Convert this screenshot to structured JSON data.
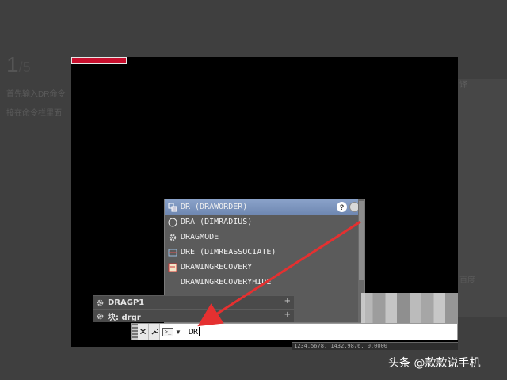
{
  "background_page": {
    "step_number": "1",
    "step_total": "/5",
    "line1": "首先输入DR命令",
    "line2": "接在命令栏里面",
    "right_label": "译",
    "right_logo": "百度"
  },
  "autocomplete": {
    "items": [
      {
        "label": "DR (DRAWORDER)",
        "icon": "draworder-icon",
        "selected": true
      },
      {
        "label": "DRA (DIMRADIUS)",
        "icon": "dimradius-icon",
        "selected": false
      },
      {
        "label": "DRAGMODE",
        "icon": "gear-icon",
        "selected": false
      },
      {
        "label": "DRE (DIMREASSOCIATE)",
        "icon": "dimreassociate-icon",
        "selected": false
      },
      {
        "label": "DRAWINGRECOVERY",
        "icon": "drawingrecovery-icon",
        "selected": false
      },
      {
        "label": "DRAWINGRECOVERYHIDE",
        "icon": "",
        "selected": false
      }
    ],
    "help_label": "?"
  },
  "history": [
    {
      "label": "DRAGP1",
      "icon": "gear-icon",
      "plus": "+"
    },
    {
      "label": "块: drgr",
      "icon": "block-icon",
      "plus": "+"
    }
  ],
  "command_line": {
    "close_label": "✕",
    "wrench_label": "🔧",
    "prompt_label": ">_",
    "value": "DR"
  },
  "status_bar": {
    "text": "1234.5678, 1432.9876, 0.0000"
  },
  "watermark": "头条 @款款说手机",
  "colors": {
    "selected_row": "#7a93bd",
    "annotation_arrow": "#e53030"
  }
}
